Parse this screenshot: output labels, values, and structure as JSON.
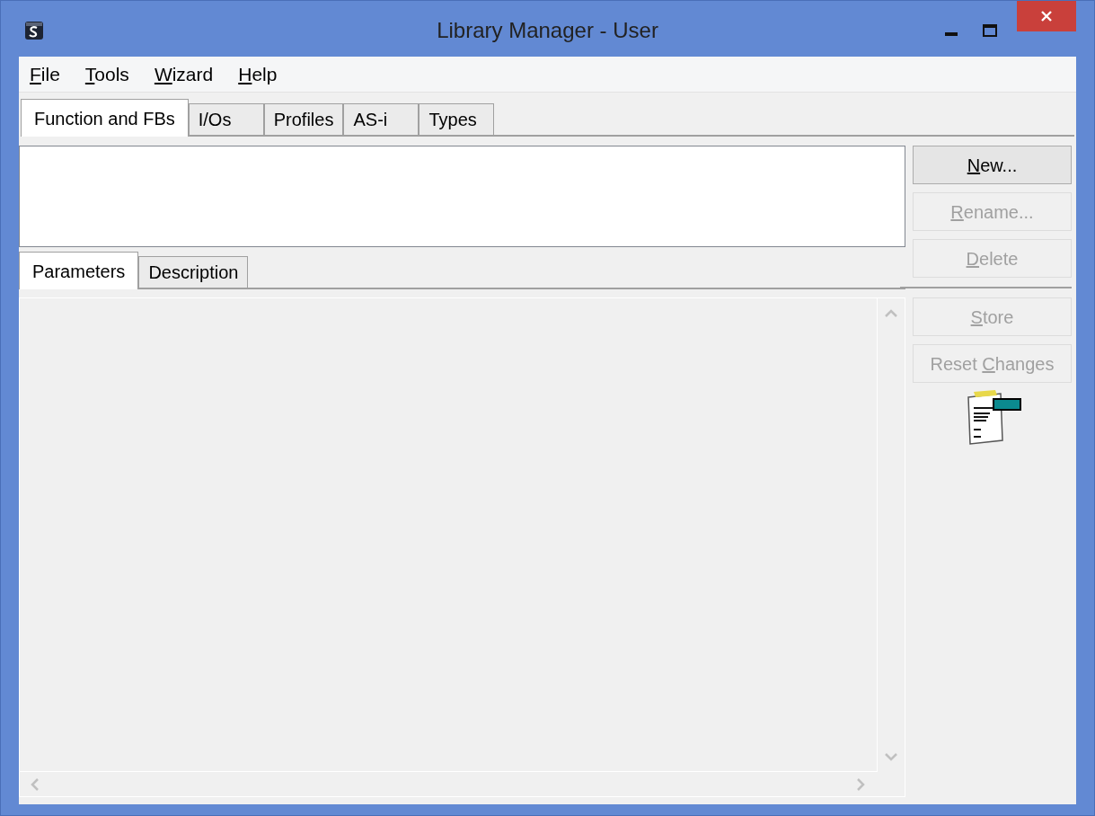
{
  "window": {
    "title": "Library Manager - User"
  },
  "menu": [
    {
      "access_key": "F",
      "label_after": "ile"
    },
    {
      "access_key": "T",
      "label_after": "ools"
    },
    {
      "access_key": "W",
      "label_after": "izard"
    },
    {
      "access_key": "H",
      "label_after": "elp"
    }
  ],
  "tabs": [
    {
      "label": "Function and FBs",
      "selected": true
    },
    {
      "label": "I/Os",
      "selected": false
    },
    {
      "label": "Profiles",
      "selected": false
    },
    {
      "label": "AS-i",
      "selected": false
    },
    {
      "label": "Types",
      "selected": false
    }
  ],
  "detail_tabs": [
    {
      "label": "Parameters",
      "selected": true
    },
    {
      "label": "Description",
      "selected": false
    }
  ],
  "buttons": [
    {
      "access_key": "N",
      "label_after": "ew...",
      "disabled": false
    },
    {
      "access_key": "R",
      "label_after": "ename...",
      "disabled": true
    },
    {
      "access_key": "D",
      "label_after": "elete",
      "disabled": true
    },
    {
      "access_key": "S",
      "label_after": "tore",
      "disabled": true
    },
    {
      "label_before": "Reset ",
      "access_key": "C",
      "label_after": "hanges",
      "disabled": true
    }
  ]
}
